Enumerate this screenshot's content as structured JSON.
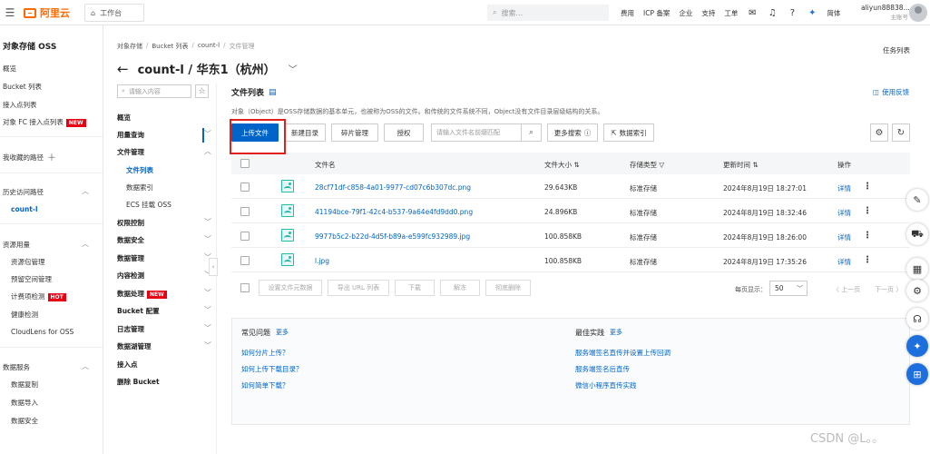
{
  "topbar": {
    "logo_text": "阿里云",
    "workspace": "工作台",
    "search_placeholder": "搜索...",
    "nav": [
      "费用",
      "ICP 备案",
      "企业",
      "支持",
      "工单"
    ],
    "lang": "简体",
    "user_name": "aliyun88838...",
    "user_role": "主账号"
  },
  "sidebar": {
    "title": "对象存储 OSS",
    "items": {
      "overview": "概览",
      "bucket_list": "Bucket 列表",
      "access_point": "接入点列表",
      "fc_access": "对象 FC 接入点列表",
      "fc_badge": "NEW",
      "favorites": "我收藏的路径",
      "history": "历史访问路径",
      "history_item": "count-l",
      "resource_usage": "资源用量",
      "res_pkg": "资源包管理",
      "capacity": "预留空间管理",
      "billing": "计费项检测",
      "billing_badge": "HOT",
      "health": "健康检测",
      "cloudlens": "CloudLens for OSS",
      "data_service": "数据服务",
      "data_copy": "数据复制",
      "data_import": "数据导入",
      "data_security": "数据安全"
    }
  },
  "breadcrumb": [
    "对象存储",
    "Bucket 列表",
    "count-l",
    "文件管理"
  ],
  "task_list": "任务列表",
  "page_title": "count-l / 华东1（杭州）",
  "bucket_nav": {
    "search_placeholder": "请输入内容",
    "items": {
      "overview": "概览",
      "usage": "用量查询",
      "file_mgmt": "文件管理",
      "file_list": "文件列表",
      "data_index": "数据索引",
      "ecs_mount": "ECS 挂载 OSS",
      "perm": "权限控制",
      "security": "数据安全",
      "data_mgmt": "数据管理",
      "content_check": "内容检测",
      "data_proc": "数据处理",
      "data_proc_badge": "NEW",
      "bucket_config": "Bucket 配置",
      "log_mgmt": "日志管理",
      "monitor": "数据湖管理",
      "access_point": "接入点",
      "delete_bucket": "删除 Bucket"
    }
  },
  "file_list": {
    "title": "文件列表",
    "feedback": "使用反馈",
    "description": "对象（Object）是OSS存储数据的基本单元，也被称为OSS的文件。和传统的文件系统不同，Object没有文件目录层级结构的关系。",
    "buttons": {
      "upload": "上传文件",
      "new_dir": "新建目录",
      "fragments": "碎片管理",
      "authorize": "授权",
      "search_placeholder": "请输入文件名前缀匹配",
      "more_search": "更多搜索",
      "data_index": "数据索引"
    },
    "columns": {
      "name": "文件名",
      "size": "文件大小",
      "storage": "存储类型",
      "updated": "更新时间",
      "ops": "操作"
    },
    "rows": [
      {
        "name": "28cf71df-c858-4a01-9977-cd07c6b307dc.png",
        "size": "29.643KB",
        "storage": "标准存储",
        "updated": "2024年8月19日 18:27:01",
        "op": "详情"
      },
      {
        "name": "41194bce-79f1-42c4-b537-9a64e4fd9dd0.png",
        "size": "24.896KB",
        "storage": "标准存储",
        "updated": "2024年8月19日 18:32:46",
        "op": "详情"
      },
      {
        "name": "9977b5c2-b22d-4d5f-b89a-e599fc932989.jpg",
        "size": "100.858KB",
        "storage": "标准存储",
        "updated": "2024年8月19日 18:26:00",
        "op": "详情"
      },
      {
        "name": "l.jpg",
        "size": "100.858KB",
        "storage": "标准存储",
        "updated": "2024年8月19日 17:35:26",
        "op": "详情"
      }
    ],
    "bulk": {
      "set_meta": "设置文件元数据",
      "export_url": "导出 URL 列表",
      "download": "下载",
      "unfreeze": "解冻",
      "delete": "彻底删除"
    },
    "pager": {
      "per_page_label": "每页显示：",
      "per_page": "50",
      "prev": "上一页",
      "next": "下一页"
    }
  },
  "faq": {
    "left_title": "常见问题",
    "right_title": "最佳实践",
    "more": "更多",
    "left": [
      "如何分片上传？",
      "如何上传下载目录？",
      "如何简单下载？"
    ],
    "right": [
      "服务端签名直传并设置上传回调",
      "服务端签名后直传",
      "微信小程序直传实践"
    ]
  },
  "watermark": "CSDN @L。。",
  "colors": {
    "accent": "#0064c8",
    "brand": "#ff6a00",
    "highlight": "#e0201b"
  }
}
